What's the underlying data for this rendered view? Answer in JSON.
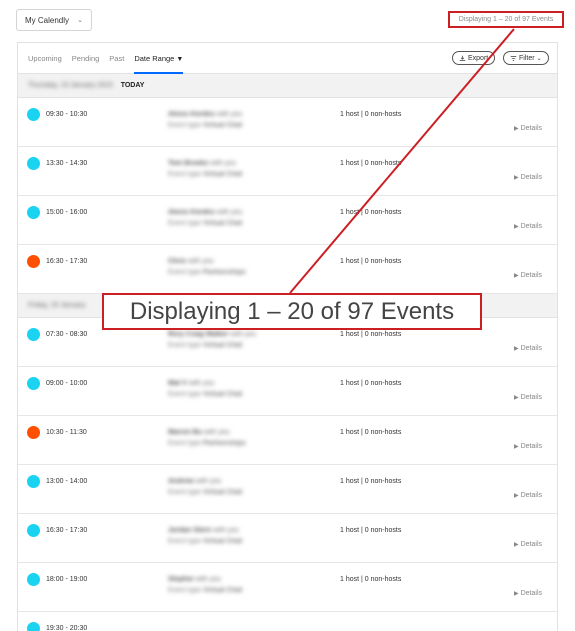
{
  "header": {
    "calendar_select": "My Calendly",
    "calendar_chevron": "⌄",
    "display_count": "Displaying 1 – 20 of 97 Events"
  },
  "tabs": [
    {
      "label": "Upcoming"
    },
    {
      "label": "Pending"
    },
    {
      "label": "Past"
    },
    {
      "label": "Date Range",
      "active": true
    }
  ],
  "date_range_arrow": "▼",
  "toolbar": {
    "export_label": "Export",
    "filter_label": "Filter",
    "filter_chevron": "⌄",
    "export_icon": "download-icon",
    "filter_icon": "filter-icon"
  },
  "day_groups": [
    {
      "date_label": "Thursday, 19 January 2023",
      "today_label": "TODAY",
      "events": [
        {
          "time": "09:30 - 10:30",
          "color": "#1ad3f0",
          "invitee": "Alexis Kordes",
          "with": "with you",
          "event_type_prefix": "Event type",
          "event_type": "Virtual Chat",
          "hosts": "1 host | 0 non-hosts",
          "details": "Details"
        },
        {
          "time": "13:30 - 14:30",
          "color": "#1ad3f0",
          "invitee": "Tom Brooks",
          "with": "with you",
          "event_type_prefix": "Event type",
          "event_type": "Virtual Chat",
          "hosts": "1 host | 0 non-hosts",
          "details": "Details"
        },
        {
          "time": "15:00 - 16:00",
          "color": "#1ad3f0",
          "invitee": "Alexis Kordes",
          "with": "with you",
          "event_type_prefix": "Event type",
          "event_type": "Virtual Chat",
          "hosts": "1 host | 0 non-hosts",
          "details": "Details"
        },
        {
          "time": "16:30 - 17:30",
          "color": "#ff4f00",
          "invitee": "Chris",
          "with": "with you",
          "event_type_prefix": "Event type",
          "event_type": "Partnerships",
          "hosts": "1 host | 0 non-hosts",
          "details": "Details"
        }
      ]
    },
    {
      "date_label": "Friday, 20 January",
      "today_label": "",
      "events": [
        {
          "time": "07:30 - 08:30",
          "color": "#1ad3f0",
          "invitee": "Rory Craig Walker",
          "with": "with you",
          "event_type_prefix": "Event type",
          "event_type": "Virtual Chat",
          "hosts": "1 host | 0 non-hosts",
          "details": "Details"
        },
        {
          "time": "09:00 - 10:00",
          "color": "#1ad3f0",
          "invitee": "Mat V",
          "with": "with you",
          "event_type_prefix": "Event type",
          "event_type": "Virtual Chat",
          "hosts": "1 host | 0 non-hosts",
          "details": "Details"
        },
        {
          "time": "10:30 - 11:30",
          "color": "#ff4f00",
          "invitee": "Marcin Bu",
          "with": "with you",
          "event_type_prefix": "Event type",
          "event_type": "Partnerships",
          "hosts": "1 host | 0 non-hosts",
          "details": "Details"
        },
        {
          "time": "13:00 - 14:00",
          "color": "#1ad3f0",
          "invitee": "Andrew",
          "with": "with you",
          "event_type_prefix": "Event type",
          "event_type": "Virtual Chat",
          "hosts": "1 host | 0 non-hosts",
          "details": "Details"
        },
        {
          "time": "16:30 - 17:30",
          "color": "#1ad3f0",
          "invitee": "Jordan Stern",
          "with": "with you",
          "event_type_prefix": "Event type",
          "event_type": "Virtual Chat",
          "hosts": "1 host | 0 non-hosts",
          "details": "Details"
        },
        {
          "time": "18:00 - 19:00",
          "color": "#1ad3f0",
          "invitee": "Stephie",
          "with": "with you",
          "event_type_prefix": "Event type",
          "event_type": "Virtual Chat",
          "hosts": "1 host | 0 non-hosts",
          "details": "Details"
        },
        {
          "time": "19:30 - 20:30",
          "color": "#1ad3f0",
          "invitee": "",
          "with": "",
          "event_type_prefix": "",
          "event_type": "",
          "hosts": "",
          "details": ""
        }
      ]
    }
  ],
  "callout": {
    "text": "Displaying 1 – 20 of 97 Events",
    "color": "#cc1f24"
  }
}
